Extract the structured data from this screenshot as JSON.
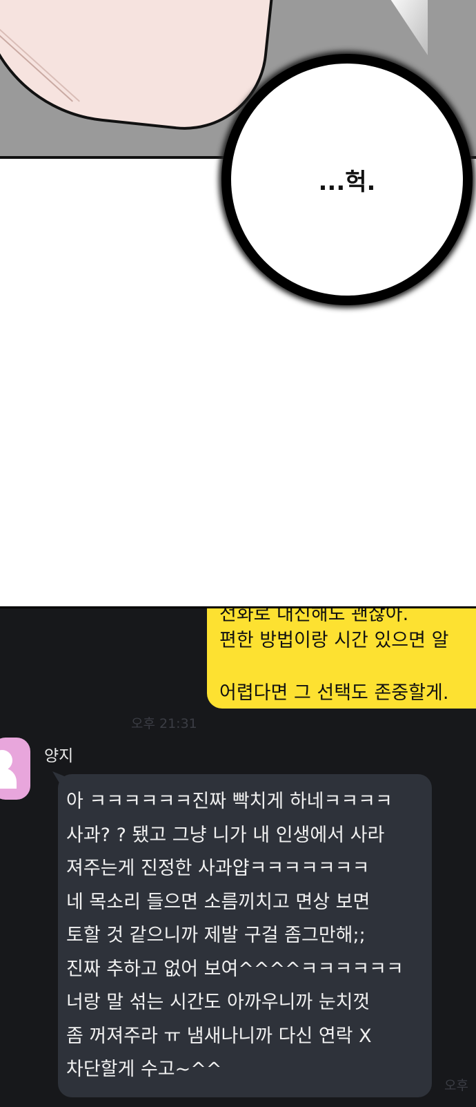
{
  "top_panel": {
    "speech": "...헉."
  },
  "chat": {
    "sent_message": "전화로 대신해도 괜찮아.\n편한 방법이랑 시간 있으면 알\n\n어렵다면 그 선택도 존중할게.",
    "sent_time": "오후 21:31",
    "sender_name": "양지",
    "received_message": "아 ㅋㅋㅋㅋㅋㅋ진짜 빡치게 하네ㅋㅋㅋㅋ\n사과? ? 됐고 그냥 니가 내 인생에서 사라\n져주는게 진정한 사과얍ㅋㅋㅋㅋㅋㅋㅋ\n네 목소리 들으면 소름끼치고 면상 보면\n토할 것 같으니까 제발 구걸 좀그만해;;\n진짜 추하고 없어 보여^^^^ㅋㅋㅋㅋㅋㅋ\n너랑 말 섞는 시간도 아까우니까 눈치껏\n좀 꺼져주라 ㅠ 냄새나니까 다신 연락 X\n차단할게 수고~^^",
    "received_time": "오후"
  },
  "colors": {
    "yellow": "#fde131",
    "dark_bg": "#17181b",
    "gray_bubble": "#2e323a",
    "avatar": "#e8a6dc"
  }
}
